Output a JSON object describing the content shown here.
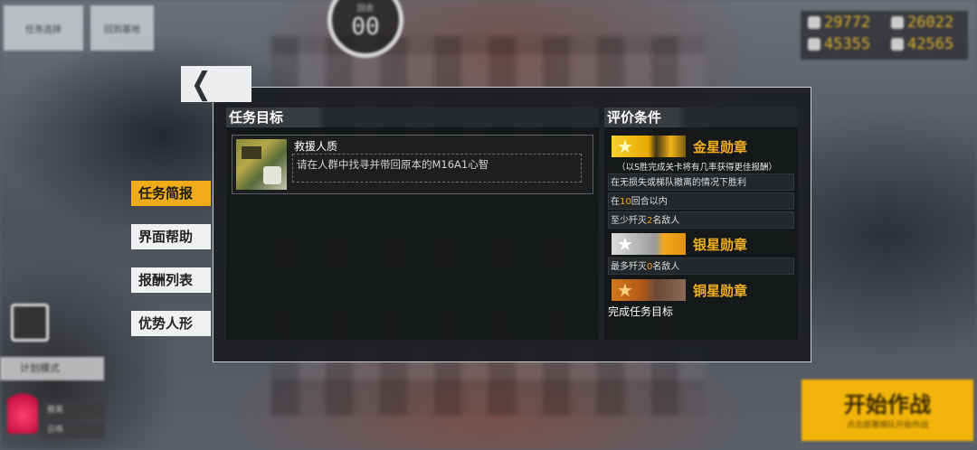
{
  "top_bar": {
    "back_label": "任务选择",
    "home_label": "回到基地",
    "turn_label": "回合",
    "turn_value": "00",
    "resources": [
      {
        "icon": "manpower-icon",
        "value": "29772"
      },
      {
        "icon": "ammo-icon",
        "value": "26022"
      },
      {
        "icon": "rations-icon",
        "value": "45355"
      },
      {
        "icon": "parts-icon",
        "value": "42565"
      }
    ]
  },
  "side_tabs": [
    {
      "label": "任务简报",
      "active": true
    },
    {
      "label": "界面帮助",
      "active": false
    },
    {
      "label": "报酬列表",
      "active": false
    },
    {
      "label": "优势人形",
      "active": false
    }
  ],
  "objectives": {
    "title": "任务目标",
    "mission_name": "救援人质",
    "mission_desc": "请在人群中找寻并带回原本的M16A1心智"
  },
  "evaluation": {
    "title": "评价条件",
    "gold": {
      "name": "金星勋章",
      "note": "（以S胜完成关卡将有几率获得更佳报酬）",
      "conditions": [
        {
          "pre": "在无损失或梯队撤离的情况下胜利",
          "hl": "",
          "post": ""
        },
        {
          "pre": "在",
          "hl": "10",
          "post": "回合以内"
        },
        {
          "pre": "至少歼灭",
          "hl": "2",
          "post": "名敌人"
        }
      ]
    },
    "silver": {
      "name": "银星勋章",
      "conditions": [
        {
          "pre": "最多歼灭",
          "hl": "0",
          "post": "名敌人"
        }
      ]
    },
    "bronze": {
      "name": "铜星勋章",
      "condition": "完成任务目标"
    }
  },
  "left_bottom": {
    "plan_mode": "计划模式",
    "hint1": "撤离",
    "hint2": "召唤"
  },
  "start_button": {
    "label": "开始作战",
    "sub": "点击部署梯队开始作战"
  },
  "colors": {
    "accent": "#f0ac18",
    "panel_bg": "#1c1e21",
    "highlight_text": "#f0a818"
  }
}
